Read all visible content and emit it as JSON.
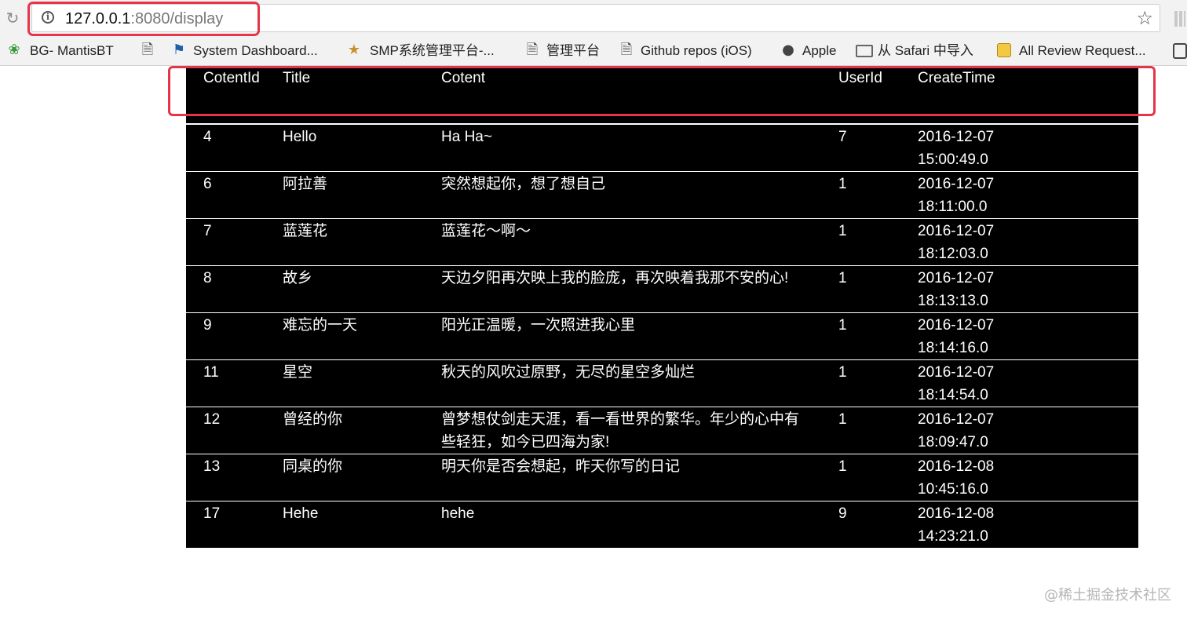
{
  "browser": {
    "url_host": "127.0.0.1",
    "url_path": ":8080/display"
  },
  "bookmarks": [
    {
      "label": "BG- MantisBT",
      "icon": "mantis-icon"
    },
    {
      "label": "",
      "icon": "page-icon"
    },
    {
      "label": "System Dashboard...",
      "icon": "dashboard-icon"
    },
    {
      "label": "SMP系统管理平台-...",
      "icon": "smp-icon"
    },
    {
      "label": "管理平台",
      "icon": "page-icon"
    },
    {
      "label": "Github repos (iOS)",
      "icon": "page-icon"
    },
    {
      "label": "Apple",
      "icon": "apple-icon"
    },
    {
      "label": "从 Safari 中导入",
      "icon": "folder-icon"
    },
    {
      "label": "All Review Request...",
      "icon": "review-icon"
    }
  ],
  "table": {
    "headers": [
      "CotentId",
      "Title",
      "Cotent",
      "UserId",
      "CreateTime"
    ],
    "rows": [
      {
        "id": "4",
        "title": "Hello",
        "content": "Ha Ha~",
        "user": "7",
        "date": "2016-12-07",
        "time": "15:00:49.0"
      },
      {
        "id": "6",
        "title": "阿拉善",
        "content": "突然想起你，想了想自己",
        "user": "1",
        "date": "2016-12-07",
        "time": "18:11:00.0"
      },
      {
        "id": "7",
        "title": "蓝莲花",
        "content": "蓝莲花～啊～",
        "user": "1",
        "date": "2016-12-07",
        "time": "18:12:03.0"
      },
      {
        "id": "8",
        "title": "故乡",
        "content": "天边夕阳再次映上我的脸庞，再次映着我那不安的心!",
        "user": "1",
        "date": "2016-12-07",
        "time": "18:13:13.0"
      },
      {
        "id": "9",
        "title": "难忘的一天",
        "content": "阳光正温暖，一次照进我心里",
        "user": "1",
        "date": "2016-12-07",
        "time": "18:14:16.0"
      },
      {
        "id": "11",
        "title": "星空",
        "content": "秋天的风吹过原野，无尽的星空多灿烂",
        "user": "1",
        "date": "2016-12-07",
        "time": "18:14:54.0"
      },
      {
        "id": "12",
        "title": "曾经的你",
        "content": "曾梦想仗剑走天涯，看一看世界的繁华。年少的心中有些轻狂，如今已四海为家!",
        "user": "1",
        "date": "2016-12-07",
        "time": "18:09:47.0"
      },
      {
        "id": "13",
        "title": "同桌的你",
        "content": "明天你是否会想起，昨天你写的日记",
        "user": "1",
        "date": "2016-12-08",
        "time": "10:45:16.0"
      },
      {
        "id": "17",
        "title": "Hehe",
        "content": "hehe",
        "user": "9",
        "date": "2016-12-08",
        "time": "14:23:21.0"
      }
    ]
  },
  "watermark": "@稀土掘金技术社区",
  "colors": {
    "highlight": "#e3364a",
    "table_bg": "#000000",
    "table_text": "#ffffff"
  }
}
